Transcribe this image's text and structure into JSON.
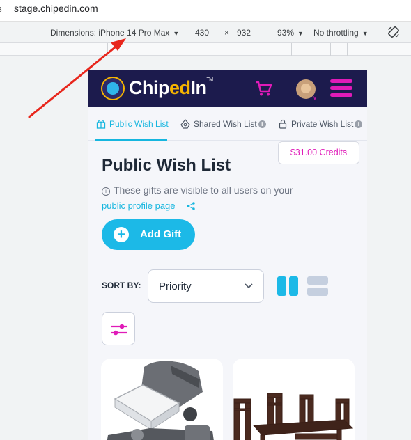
{
  "browser": {
    "url": "stage.chipedin.com",
    "device_toolbar": {
      "dimensions_label": "Dimensions: iPhone 14 Pro Max",
      "width": "430",
      "times": "×",
      "height": "932",
      "zoom": "93%",
      "throttling": "No throttling"
    }
  },
  "app": {
    "brand": {
      "pre": "Chip",
      "mid": "ed",
      "post": "In",
      "tm": "TM"
    },
    "tabs": [
      {
        "label": "Public Wish List",
        "active": true
      },
      {
        "label": "Shared Wish List",
        "active": false
      },
      {
        "label": "Private Wish List",
        "active": false
      }
    ],
    "credits": "$31.00 Credits",
    "page_title": "Public Wish List",
    "description": "These gifts are visible to all users on your",
    "profile_link": "public profile page",
    "add_gift": "Add Gift",
    "sort_label": "SORT BY:",
    "sort_value": "Priority",
    "colors": {
      "navy": "#1c1b4d",
      "cyan": "#1cb9e7",
      "magenta": "#e01bb8",
      "gold": "#f5b400"
    }
  }
}
